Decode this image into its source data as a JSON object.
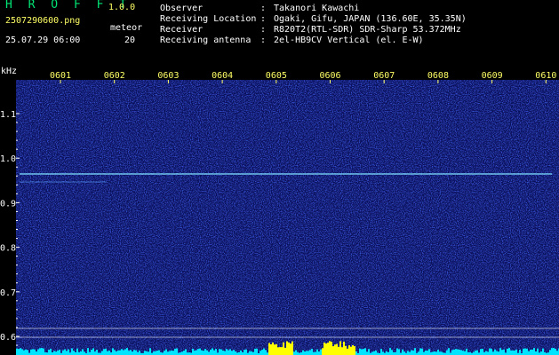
{
  "header": {
    "app_name": "H R O F F T",
    "version": "1.0.0",
    "file_name": "2507290600.png",
    "timestamp": "25.07.29 06:00",
    "meteor_label": "meteor",
    "meteor_count": "20"
  },
  "meta": [
    {
      "key": "Observer",
      "value": "Takanori Kawachi"
    },
    {
      "key": "Receiving Location",
      "value": "Ogaki, Gifu, JAPAN (136.60E, 35.35N)"
    },
    {
      "key": "Receiver",
      "value": "R820T2(RTL-SDR) SDR-Sharp 53.372MHz"
    },
    {
      "key": "Receiving antenna",
      "value": "2el-HB9CV Vertical (el. E-W)"
    }
  ],
  "colon": ":",
  "axis": {
    "y_unit": "kHz",
    "y_ticks": [
      "1.1",
      "1.0",
      "0.9",
      "0.8",
      "0.7",
      "0.6"
    ],
    "x_ticks": [
      "0601",
      "0602",
      "0603",
      "0604",
      "0605",
      "0606",
      "0607",
      "0608",
      "0609",
      "0610"
    ]
  },
  "colors": {
    "background": "#000000",
    "waterfall": "#0a0f5a",
    "header_green": "#00e676",
    "header_yellow": "#ffff66",
    "carrier": "#7fe0ff",
    "histogram": "#00e5ff",
    "histogram_peak": "#ffff00"
  }
}
